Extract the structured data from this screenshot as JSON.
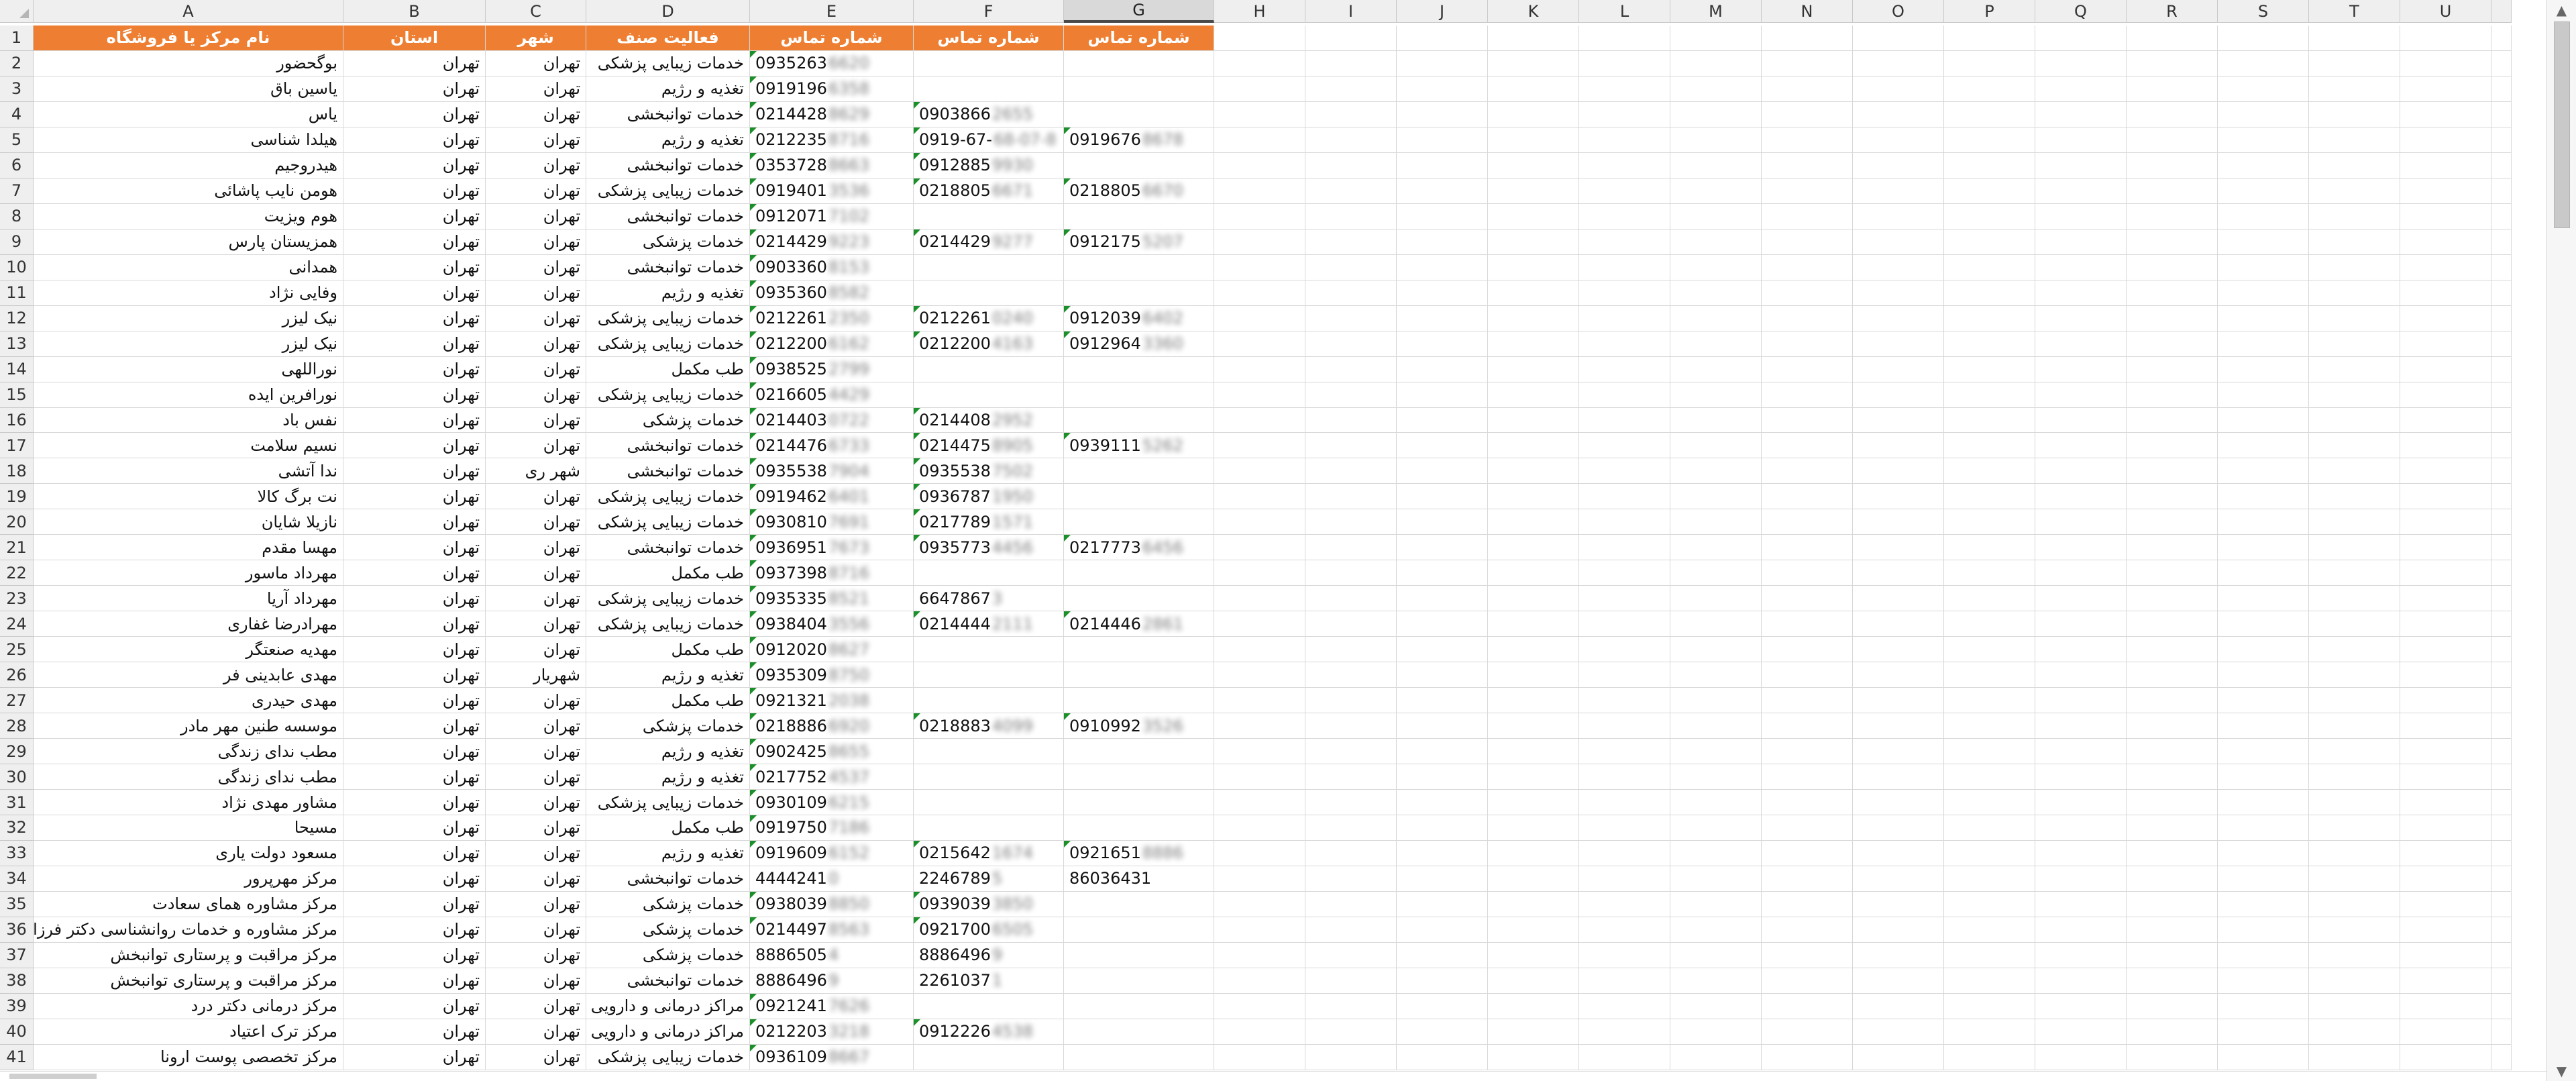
{
  "sheet": {
    "columns": [
      "A",
      "B",
      "C",
      "D",
      "E",
      "F",
      "G",
      "H",
      "I",
      "J",
      "K",
      "L",
      "M",
      "N",
      "O",
      "P",
      "Q",
      "R",
      "S",
      "T",
      "U"
    ],
    "selected_column": "G",
    "row_numbers": [
      1,
      2,
      3,
      4,
      5,
      6,
      7,
      8,
      9,
      10,
      11,
      12,
      13,
      14,
      15,
      16,
      17,
      18,
      19,
      20,
      21,
      22,
      23,
      24,
      25,
      26,
      27,
      28,
      29,
      30,
      31,
      32,
      33,
      34,
      35,
      36,
      37,
      38,
      39,
      40,
      41
    ],
    "header_row": [
      "نام مرکز یا فروشگاه",
      "استان",
      "شهر",
      "فعالیت صنف",
      "شماره تماس",
      "شماره تماس",
      "شماره تماس"
    ],
    "rows": [
      {
        "a": "بوگحضور",
        "b": "تهران",
        "c": "تهران",
        "d": "خدمات زیبایی پزشکی",
        "e": "0935263",
        "e2": "6620",
        "f": "",
        "f2": "",
        "g": "",
        "g2": "",
        "tri_e": true,
        "tri_f": false,
        "tri_g": false
      },
      {
        "a": "یاسین باق",
        "b": "تهران",
        "c": "تهران",
        "d": "تغذیه و رژیم",
        "e": "0919196",
        "e2": "6358",
        "f": "",
        "f2": "",
        "g": "",
        "g2": "",
        "tri_e": true,
        "tri_f": false,
        "tri_g": false
      },
      {
        "a": "یاس",
        "b": "تهران",
        "c": "تهران",
        "d": "خدمات توانبخشی",
        "e": "0214428",
        "e2": "8629",
        "f": "0903866",
        "f2": "2655",
        "g": "",
        "g2": "",
        "tri_e": true,
        "tri_f": true,
        "tri_g": false
      },
      {
        "a": "هیلدا شناسی",
        "b": "تهران",
        "c": "تهران",
        "d": "تغذیه و رژیم",
        "e": "0212235",
        "e2": "8716",
        "f": "0919-67-",
        "f2": "68-07-8",
        "g": "0919676",
        "g2": "8678",
        "tri_e": true,
        "tri_f": true,
        "tri_g": true
      },
      {
        "a": "هیدروجیم",
        "b": "تهران",
        "c": "تهران",
        "d": "خدمات توانبخشی",
        "e": "0353728",
        "e2": "8663",
        "f": "0912885",
        "f2": "9930",
        "g": "",
        "g2": "",
        "tri_e": true,
        "tri_f": true,
        "tri_g": false
      },
      {
        "a": "هومن نایب پاشائی",
        "b": "تهران",
        "c": "تهران",
        "d": "خدمات زیبایی پزشکی",
        "e": "0919401",
        "e2": "3536",
        "f": "0218805",
        "f2": "6671",
        "g": "0218805",
        "g2": "6670",
        "tri_e": true,
        "tri_f": true,
        "tri_g": true
      },
      {
        "a": "هوم ویزیت",
        "b": "تهران",
        "c": "تهران",
        "d": "خدمات توانبخشی",
        "e": "0912071",
        "e2": "7102",
        "f": "",
        "f2": "",
        "g": "",
        "g2": "",
        "tri_e": true,
        "tri_f": false,
        "tri_g": false
      },
      {
        "a": "همزیستان پارس",
        "b": "تهران",
        "c": "تهران",
        "d": "خدمات پزشکی",
        "e": "0214429",
        "e2": "9223",
        "f": "0214429",
        "f2": "9277",
        "g": "0912175",
        "g2": "5207",
        "tri_e": true,
        "tri_f": true,
        "tri_g": true
      },
      {
        "a": "همدانی",
        "b": "تهران",
        "c": "تهران",
        "d": "خدمات توانبخشی",
        "e": "0903360",
        "e2": "8153",
        "f": "",
        "f2": "",
        "g": "",
        "g2": "",
        "tri_e": true,
        "tri_f": false,
        "tri_g": false
      },
      {
        "a": "وفایی نژاد",
        "b": "تهران",
        "c": "تهران",
        "d": "تغذیه و رژیم",
        "e": "0935360",
        "e2": "8582",
        "f": "",
        "f2": "",
        "g": "",
        "g2": "",
        "tri_e": true,
        "tri_f": false,
        "tri_g": false
      },
      {
        "a": "نیک لیزر",
        "b": "تهران",
        "c": "تهران",
        "d": "خدمات زیبایی پزشکی",
        "e": "0212261",
        "e2": "2350",
        "f": "0212261",
        "f2": "0240",
        "g": "0912039",
        "g2": "6402",
        "tri_e": true,
        "tri_f": true,
        "tri_g": true
      },
      {
        "a": "نیک لیزر",
        "b": "تهران",
        "c": "تهران",
        "d": "خدمات زیبایی پزشکی",
        "e": "0212200",
        "e2": "6162",
        "f": "0212200",
        "f2": "4163",
        "g": "0912964",
        "g2": "3360",
        "tri_e": true,
        "tri_f": true,
        "tri_g": true
      },
      {
        "a": "نوراللهی",
        "b": "تهران",
        "c": "تهران",
        "d": "طب مکمل",
        "e": "0938525",
        "e2": "2799",
        "f": "",
        "f2": "",
        "g": "",
        "g2": "",
        "tri_e": true,
        "tri_f": false,
        "tri_g": false
      },
      {
        "a": "نورافرین ایده",
        "b": "تهران",
        "c": "تهران",
        "d": "خدمات زیبایی پزشکی",
        "e": "0216605",
        "e2": "4429",
        "f": "",
        "f2": "",
        "g": "",
        "g2": "",
        "tri_e": true,
        "tri_f": false,
        "tri_g": false
      },
      {
        "a": "نفس باد",
        "b": "تهران",
        "c": "تهران",
        "d": "خدمات پزشکی",
        "e": "0214403",
        "e2": "0722",
        "f": "0214408",
        "f2": "2952",
        "g": "",
        "g2": "",
        "tri_e": true,
        "tri_f": true,
        "tri_g": false
      },
      {
        "a": "نسیم سلامت",
        "b": "تهران",
        "c": "تهران",
        "d": "خدمات توانبخشی",
        "e": "0214476",
        "e2": "6733",
        "f": "0214475",
        "f2": "8905",
        "g": "0939111",
        "g2": "5262",
        "tri_e": true,
        "tri_f": true,
        "tri_g": true
      },
      {
        "a": "ندا آتشی",
        "b": "تهران",
        "c": "شهر ری",
        "d": "خدمات توانبخشی",
        "e": "0935538",
        "e2": "7904",
        "f": "0935538",
        "f2": "7502",
        "g": "",
        "g2": "",
        "tri_e": true,
        "tri_f": true,
        "tri_g": false
      },
      {
        "a": "نت برگ کالا",
        "b": "تهران",
        "c": "تهران",
        "d": "خدمات زیبایی پزشکی",
        "e": "0919462",
        "e2": "6401",
        "f": "0936787",
        "f2": "1950",
        "g": "",
        "g2": "",
        "tri_e": true,
        "tri_f": true,
        "tri_g": false
      },
      {
        "a": "نازیلا شایان",
        "b": "تهران",
        "c": "تهران",
        "d": "خدمات زیبایی پزشکی",
        "e": "0930810",
        "e2": "7691",
        "f": "0217789",
        "f2": "1571",
        "g": "",
        "g2": "",
        "tri_e": true,
        "tri_f": true,
        "tri_g": false
      },
      {
        "a": "مهسا مقدم",
        "b": "تهران",
        "c": "تهران",
        "d": "خدمات توانبخشی",
        "e": "0936951",
        "e2": "7673",
        "f": "0935773",
        "f2": "4456",
        "g": "0217773",
        "g2": "6456",
        "tri_e": true,
        "tri_f": true,
        "tri_g": true
      },
      {
        "a": "مهرداد ماسور",
        "b": "تهران",
        "c": "تهران",
        "d": "طب مکمل",
        "e": "0937398",
        "e2": "8716",
        "f": "",
        "f2": "",
        "g": "",
        "g2": "",
        "tri_e": true,
        "tri_f": false,
        "tri_g": false
      },
      {
        "a": "مهرداد آریا",
        "b": "تهران",
        "c": "تهران",
        "d": "خدمات زیبایی پزشکی",
        "e": "0935335",
        "e2": "8521",
        "f": "6647867",
        "f2": "3",
        "g": "",
        "g2": "",
        "tri_e": true,
        "tri_f": false,
        "tri_g": false
      },
      {
        "a": "مهرادرضا غفاری",
        "b": "تهران",
        "c": "تهران",
        "d": "خدمات زیبایی پزشکی",
        "e": "0938404",
        "e2": "3556",
        "f": "0214444",
        "f2": "2111",
        "g": "0214446",
        "g2": "2861",
        "tri_e": true,
        "tri_f": true,
        "tri_g": true
      },
      {
        "a": "مهدیه صنعتگر",
        "b": "تهران",
        "c": "تهران",
        "d": "طب مکمل",
        "e": "0912020",
        "e2": "8627",
        "f": "",
        "f2": "",
        "g": "",
        "g2": "",
        "tri_e": true,
        "tri_f": false,
        "tri_g": false
      },
      {
        "a": "مهدی عابدینی فر",
        "b": "تهران",
        "c": "شهریار",
        "d": "تغذیه و رژیم",
        "e": "0935309",
        "e2": "8750",
        "f": "",
        "f2": "",
        "g": "",
        "g2": "",
        "tri_e": true,
        "tri_f": false,
        "tri_g": false
      },
      {
        "a": "مهدی حیدری",
        "b": "تهران",
        "c": "تهران",
        "d": "طب مکمل",
        "e": "0921321",
        "e2": "2038",
        "f": "",
        "f2": "",
        "g": "",
        "g2": "",
        "tri_e": true,
        "tri_f": false,
        "tri_g": false
      },
      {
        "a": "موسسه طنین مهر مادر",
        "b": "تهران",
        "c": "تهران",
        "d": "خدمات پزشکی",
        "e": "0218886",
        "e2": "6920",
        "f": "0218883",
        "f2": "4099",
        "g": "0910992",
        "g2": "3526",
        "tri_e": true,
        "tri_f": true,
        "tri_g": true
      },
      {
        "a": "مطب ندای زندگی",
        "b": "تهران",
        "c": "تهران",
        "d": "تغذیه و رژیم",
        "e": "0902425",
        "e2": "8655",
        "f": "",
        "f2": "",
        "g": "",
        "g2": "",
        "tri_e": true,
        "tri_f": false,
        "tri_g": false
      },
      {
        "a": "مطب ندای زندگی",
        "b": "تهران",
        "c": "تهران",
        "d": "تغذیه و رژیم",
        "e": "0217752",
        "e2": "4537",
        "f": "",
        "f2": "",
        "g": "",
        "g2": "",
        "tri_e": true,
        "tri_f": false,
        "tri_g": false
      },
      {
        "a": "مشاور مهدی نژاد",
        "b": "تهران",
        "c": "تهران",
        "d": "خدمات زیبایی پزشکی",
        "e": "0930109",
        "e2": "6215",
        "f": "",
        "f2": "",
        "g": "",
        "g2": "",
        "tri_e": true,
        "tri_f": false,
        "tri_g": false
      },
      {
        "a": "مسیحا",
        "b": "تهران",
        "c": "تهران",
        "d": "طب مکمل",
        "e": "0919750",
        "e2": "7186",
        "f": "",
        "f2": "",
        "g": "",
        "g2": "",
        "tri_e": true,
        "tri_f": false,
        "tri_g": false
      },
      {
        "a": "مسعود دولت یاری",
        "b": "تهران",
        "c": "تهران",
        "d": "تغذیه و رژیم",
        "e": "0919609",
        "e2": "6152",
        "f": "0215642",
        "f2": "1674",
        "g": "0921651",
        "g2": "8886",
        "tri_e": true,
        "tri_f": true,
        "tri_g": true
      },
      {
        "a": "مرکز مهرپرور",
        "b": "تهران",
        "c": "تهران",
        "d": "خدمات توانبخشی",
        "e": "4444241",
        "e2": "0",
        "f": "2246789",
        "f2": "5",
        "g": "86036431",
        "g2": "",
        "tri_e": false,
        "tri_f": false,
        "tri_g": false
      },
      {
        "a": "مرکز مشاوره همای سعادت",
        "b": "تهران",
        "c": "تهران",
        "d": "خدمات پزشکی",
        "e": "0938039",
        "e2": "8850",
        "f": "0939039",
        "f2": "3850",
        "g": "",
        "g2": "",
        "tri_e": true,
        "tri_f": true,
        "tri_g": false
      },
      {
        "a": "مرکز مشاوره و خدمات روانشناسی دکتر فرزانه",
        "b": "تهران",
        "c": "تهران",
        "d": "خدمات پزشکی",
        "e": "0214497",
        "e2": "8563",
        "f": "0921700",
        "f2": "6505",
        "g": "",
        "g2": "",
        "tri_e": true,
        "tri_f": true,
        "tri_g": false
      },
      {
        "a": "مرکز مراقبت و پرستاری توانبخش",
        "b": "تهران",
        "c": "تهران",
        "d": "خدمات پزشکی",
        "e": "8886505",
        "e2": "4",
        "f": "8886496",
        "f2": "9",
        "g": "",
        "g2": "",
        "tri_e": false,
        "tri_f": false,
        "tri_g": false
      },
      {
        "a": "مرکز مراقبت و پرستاری توانبخش",
        "b": "تهران",
        "c": "تهران",
        "d": "خدمات توانبخشی",
        "e": "8886496",
        "e2": "9",
        "f": "2261037",
        "f2": "1",
        "g": "",
        "g2": "",
        "tri_e": false,
        "tri_f": false,
        "tri_g": false
      },
      {
        "a": "مرکز درمانی دکتر درد",
        "b": "تهران",
        "c": "تهران",
        "d": "مراکز درمانی و دارویی",
        "e": "0921241",
        "e2": "7626",
        "f": "",
        "f2": "",
        "g": "",
        "g2": "",
        "tri_e": true,
        "tri_f": false,
        "tri_g": false
      },
      {
        "a": "مرکز ترک اعتیاد",
        "b": "تهران",
        "c": "تهران",
        "d": "مراکز درمانی و دارویی",
        "e": "0212203",
        "e2": "3218",
        "f": "0912226",
        "f2": "4538",
        "g": "",
        "g2": "",
        "tri_e": true,
        "tri_f": true,
        "tri_g": false
      },
      {
        "a": "مرکز تخصصی پوست ارونا",
        "b": "تهران",
        "c": "تهران",
        "d": "خدمات زیبایی پزشکی",
        "e": "0936109",
        "e2": "8667",
        "f": "",
        "f2": "",
        "g": "",
        "g2": "",
        "tri_e": true,
        "tri_f": false,
        "tri_g": false
      }
    ]
  },
  "ui": {
    "scroll_up_icon": "chevron-up-icon",
    "scroll_down_icon": "chevron-down-icon",
    "header_fill": "#ee7f32",
    "triangle_color": "#1b8f2a"
  }
}
